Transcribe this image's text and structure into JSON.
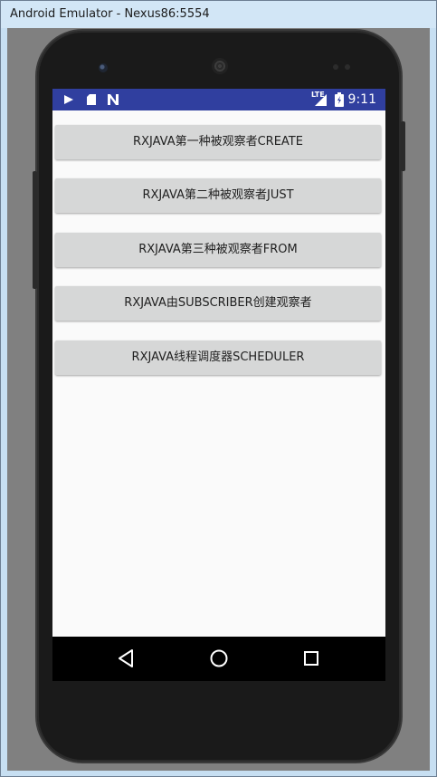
{
  "window": {
    "title": "Android Emulator - Nexus86:5554"
  },
  "statusbar": {
    "time": "9:11",
    "network_label": "LTE",
    "icons": [
      "play-icon",
      "sd-card-icon",
      "n-notification-icon",
      "signal-icon",
      "battery-icon"
    ],
    "color": "#303f9f"
  },
  "app": {
    "buttons": [
      {
        "label": "RXJAVA第一种被观察者CREATE"
      },
      {
        "label": "RXJAVA第二种被观察者JUST"
      },
      {
        "label": "RXJAVA第三种被观察者FROM"
      },
      {
        "label": "RXJAVA由SUBSCRIBER创建观察者"
      },
      {
        "label": "RXJAVA线程调度器SCHEDULER"
      }
    ]
  },
  "navbar": {
    "keys": [
      "back-icon",
      "home-icon",
      "recents-icon"
    ]
  }
}
